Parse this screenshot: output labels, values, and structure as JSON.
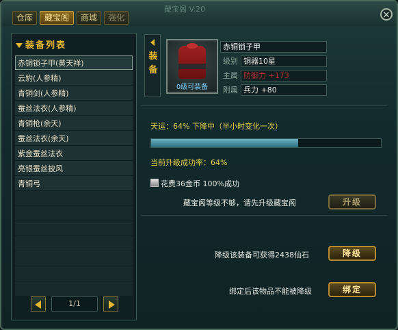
{
  "window": {
    "title": "藏宝阁 V.20"
  },
  "tabs": [
    {
      "label": "仓库",
      "active": false
    },
    {
      "label": "藏宝阁",
      "active": true
    },
    {
      "label": "商城",
      "active": false
    },
    {
      "label": "强化",
      "active": false
    }
  ],
  "list": {
    "header": "装备列表",
    "items": [
      {
        "label": "赤铜锁子甲(黄天祥)",
        "selected": true
      },
      {
        "label": "云豹(人参精)",
        "selected": false
      },
      {
        "label": "青铜剑(人参精)",
        "selected": false
      },
      {
        "label": "蚕丝法衣(人参精)",
        "selected": false
      },
      {
        "label": "青铜枪(余天)",
        "selected": false
      },
      {
        "label": "蚕丝法衣(余天)",
        "selected": false
      },
      {
        "label": "紫金蚕丝法衣",
        "selected": false
      },
      {
        "label": "亮银蚕丝披风",
        "selected": false
      },
      {
        "label": "青铜弓",
        "selected": false
      }
    ],
    "empty_rows": 7,
    "pager": {
      "text": "1/1"
    }
  },
  "equip": {
    "side_label": "装备",
    "icon_caption": "0级可装备",
    "name": "赤铜锁子甲",
    "attrs": [
      {
        "label": "级别",
        "value": "铜器10星",
        "color": "#e8e8e0"
      },
      {
        "label": "主属",
        "value": "防御力 +173",
        "color": "#b03030"
      },
      {
        "label": "附属",
        "value": "兵力 +80",
        "color": "#e8e8e0"
      }
    ]
  },
  "upgrade": {
    "luck_text": "天运：64%  下降中（半小时变化一次）",
    "luck_percent": 64,
    "rate_text": "当前升级成功率：64%",
    "cost_text": "花费36金币 100%成功",
    "warn_text": "藏宝阁等级不够，请先升级藏宝阁",
    "upgrade_button": "升级"
  },
  "downgrade": {
    "info_text": "降级该装备可获得2438仙石",
    "button": "降级"
  },
  "bind": {
    "info_text": "绑定后该物品不能被降级",
    "button": "绑定"
  },
  "colors": {
    "accent": "#e6b830",
    "text_yellow": "#e6d24a",
    "bar_fill": "#4a98a8"
  }
}
